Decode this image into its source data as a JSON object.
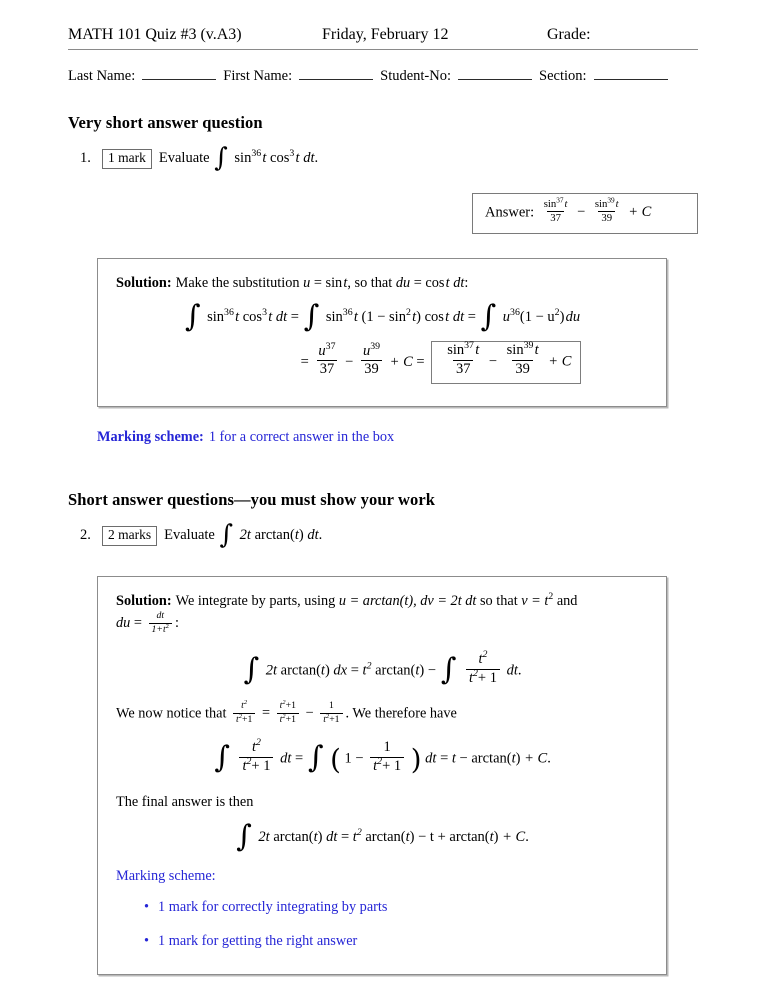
{
  "header": {
    "quiz_title": "MATH 101 Quiz #3 (v.A3)",
    "date": "Friday, February 12",
    "grade_label": "Grade:"
  },
  "name_fields": {
    "last_name_label": "Last Name:",
    "first_name_label": "First Name:",
    "student_no_label": "Student-No:",
    "section_label": "Section:"
  },
  "sections": [
    {
      "heading": "Very short answer question"
    },
    {
      "heading": "Short answer questions—you must show your work"
    }
  ],
  "question1": {
    "number": "1.",
    "marks_badge": "1 mark",
    "prompt": "Evaluate",
    "integral_symbol": "∫",
    "integrand": {
      "sin_base": "sin",
      "sin_exponent": "36",
      "var1": "t",
      "cos_base": "cos",
      "cos_exponent": "3",
      "var2": "t",
      "differential": "dt",
      "period": "."
    },
    "answer_box": {
      "label": "Answer:",
      "term1_num_base": "sin",
      "term1_num_exp": "37",
      "term1_num_var": "t",
      "term1_den": "37",
      "minus": "−",
      "term2_num_base": "sin",
      "term2_num_exp": "39",
      "term2_num_var": "t",
      "term2_den": "39",
      "plus_c": "+ C"
    }
  },
  "solution1": {
    "lead": "Solution:",
    "intro_a": "Make the substitution",
    "sub_u": "u",
    "eq1": "=",
    "sin_t": "sin",
    "sub_t": "t",
    "intro_b": ", so that",
    "du": "du",
    "eq2": "=",
    "cos_t": "cos",
    "cos_var": "t",
    "dt": "dt",
    "colon": ":",
    "line1": {
      "lhs_sin_base": "sin",
      "lhs_sin_exp": "36",
      "lhs_var": "t",
      "lhs_cos_base": "cos",
      "lhs_cos_exp": "3",
      "lhs_var2": "t",
      "lhs_dt": "dt",
      "equals1": "=",
      "mid_sin_base": "sin",
      "mid_sin_exp": "36",
      "mid_var": "t",
      "mid_paren_open": "(1 − sin",
      "mid_paren_exp": "2",
      "mid_paren_var": "t",
      "mid_paren_close": ")",
      "mid_cos": "cos",
      "mid_cos_var": "t",
      "mid_dt": "dt",
      "equals2": "=",
      "rhs_u": "u",
      "rhs_u_exp": "36",
      "rhs_rest_open": "(1 − u",
      "rhs_rest_exp": "2",
      "rhs_rest_close": ")",
      "rhs_du": "du"
    },
    "line2": {
      "equals": "=",
      "f1_num_u": "u",
      "f1_num_exp": "37",
      "f1_den": "37",
      "minus": "−",
      "f2_num_u": "u",
      "f2_num_exp": "39",
      "f2_den": "39",
      "plus_c": "+ C",
      "equals2": "=",
      "boxed": {
        "t1_base": "sin",
        "t1_exp": "37",
        "t1_var": "t",
        "t1_den": "37",
        "minus": "−",
        "t2_base": "sin",
        "t2_exp": "39",
        "t2_var": "t",
        "t2_den": "39",
        "plus_c": "+ C"
      }
    }
  },
  "marking1": {
    "lead": "Marking scheme:",
    "text": "1 for a correct answer in the box"
  },
  "question2": {
    "number": "2.",
    "marks_badge": "2 marks",
    "prompt": "Evaluate",
    "integral_symbol": "∫",
    "integrand": {
      "coef": "2",
      "var": "t",
      "func": "arctan(",
      "func_var": "t",
      "func_close": ")",
      "differential": "dt",
      "period": "."
    }
  },
  "solution2": {
    "lead": "Solution:",
    "intro": "We integrate by parts, using",
    "u_eq": "u  =  arctan(t),",
    "dv_eq": "dv  =  2t dt",
    "so_that": "so that",
    "v_eq": "v  =  t",
    "v_exp": "2",
    "and": "and",
    "du_lead": "du",
    "du_eq": "=",
    "du_num": "dt",
    "du_den": "1+t",
    "du_den_exp": "2",
    "du_colon": ":",
    "eq_a": {
      "lhs_coef": "2",
      "lhs_var": "t",
      "lhs_arctan": "arctan(",
      "lhs_arg": "t",
      "lhs_close": ")",
      "lhs_dx": "dx",
      "equals": "=",
      "rhs_t": "t",
      "rhs_exp": "2",
      "rhs_arctan": "arctan(",
      "rhs_arg": "t",
      "rhs_close": ")",
      "minus": "−",
      "frac_num_t": "t",
      "frac_num_exp": "2",
      "frac_den_t": "t",
      "frac_den_exp": "2",
      "frac_den_plus": "+ 1",
      "dt": "dt",
      "period": "."
    },
    "notice_a": "We now notice that",
    "notice_f1_num_t": "t",
    "notice_f1_num_exp": "2",
    "notice_f1_den_t": "t",
    "notice_f1_den_exp": "2",
    "notice_f1_den_plus": "+1",
    "notice_eq": "=",
    "notice_f2_num": "t",
    "notice_f2_num_exp": "2",
    "notice_f2_num_plus": "+1",
    "notice_f2_den": "t",
    "notice_f2_den_exp": "2",
    "notice_f2_den_plus": "+1",
    "notice_minus": "−",
    "notice_f3_num": "1",
    "notice_f3_den": "t",
    "notice_f3_den_exp": "2",
    "notice_f3_den_plus": "+1",
    "notice_b": ". We therefore have",
    "eq_b": {
      "f1_num_t": "t",
      "f1_num_exp": "2",
      "f1_den_t": "t",
      "f1_den_exp": "2",
      "f1_den_plus": "+ 1",
      "dt1": "dt",
      "equals1": "=",
      "paren_open": "(",
      "one": "1",
      "minus": "−",
      "f2_num": "1",
      "f2_den_t": "t",
      "f2_den_exp": "2",
      "f2_den_plus": "+ 1",
      "paren_close": ")",
      "dt2": "dt",
      "equals2": "=",
      "result_t": "t",
      "result_minus": "−",
      "result_arctan": "arctan(",
      "result_arg": "t",
      "result_close": ")",
      "result_plus_c": "+ C",
      "period": "."
    },
    "final_lead": "The final answer is then",
    "eq_c": {
      "lhs_coef": "2",
      "lhs_var": "t",
      "lhs_arctan": "arctan(",
      "lhs_arg": "t",
      "lhs_close": ")",
      "lhs_dt": "dt",
      "equals": "=",
      "rhs_t": "t",
      "rhs_exp": "2",
      "rhs_arctan": "arctan(",
      "rhs_arg": "t",
      "rhs_close": ")",
      "minus_t": "− t",
      "plus_arctan": "+ arctan(",
      "plus_arg": "t",
      "plus_close": ")",
      "plus_c": "+ C",
      "period": "."
    },
    "marking": {
      "lead": "Marking scheme:",
      "bullet_symbol": "•",
      "items": [
        "1 mark for correctly integrating by parts",
        "1 mark for getting the right answer"
      ]
    }
  },
  "colors": {
    "marking_blue": "#2626d6",
    "box_border": "#8c8c8c",
    "rule_gray": "#8a8a8a"
  }
}
